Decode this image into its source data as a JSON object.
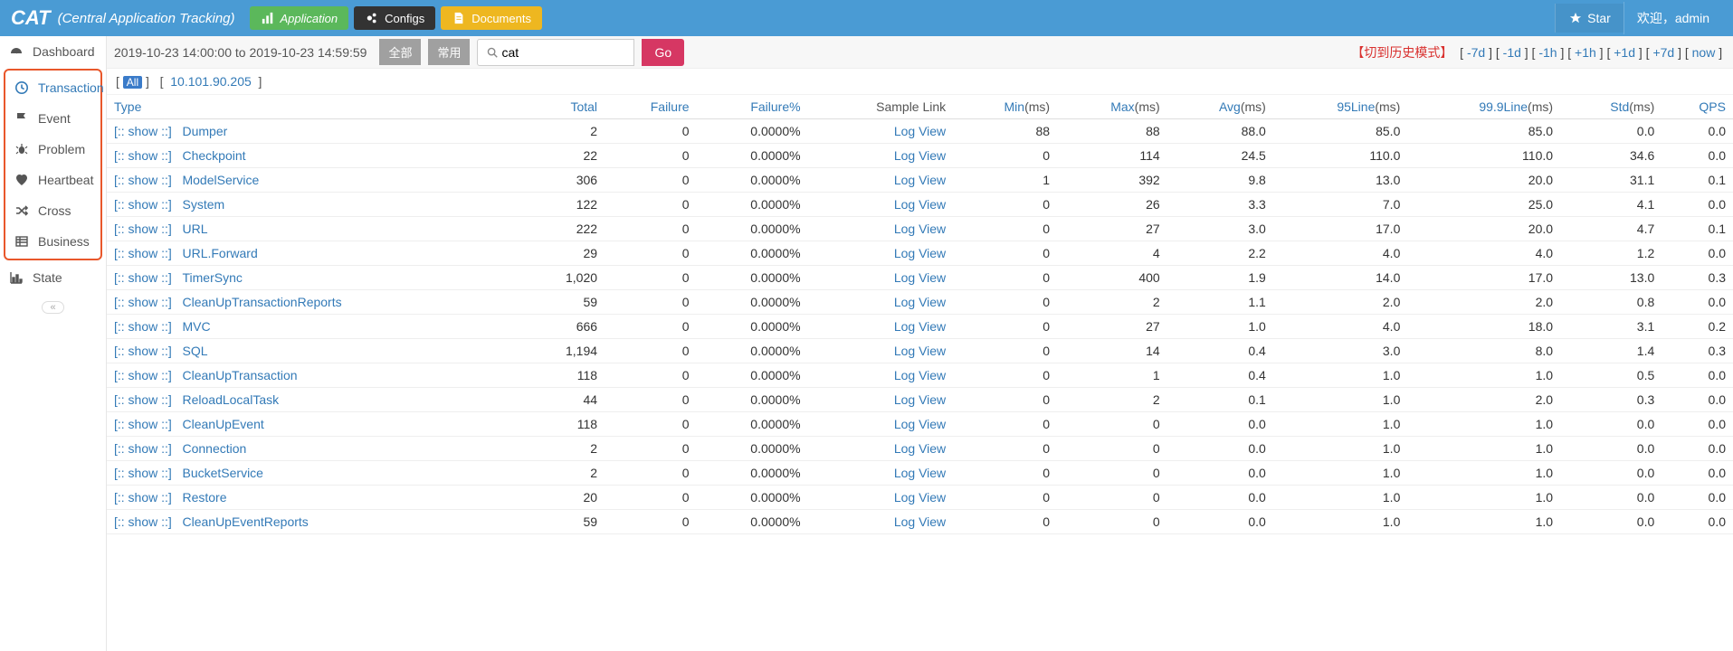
{
  "header": {
    "brand": "CAT",
    "brand_sub": "(Central Application Tracking)",
    "nav": {
      "application": "Application",
      "configs": "Configs",
      "documents": "Documents"
    },
    "star": "Star",
    "welcome": "欢迎，admin"
  },
  "sidebar": {
    "dashboard": "Dashboard",
    "transaction": "Transaction",
    "event": "Event",
    "problem": "Problem",
    "heartbeat": "Heartbeat",
    "cross": "Cross",
    "business": "Business",
    "state": "State",
    "collapse": "«"
  },
  "timebar": {
    "range": "2019-10-23 14:00:00 to 2019-10-23 14:59:59",
    "seg_all": "全部",
    "seg_common": "常用",
    "search_value": "cat",
    "go": "Go",
    "history_label": "【切到历史模式】",
    "links": {
      "m7d": "-7d",
      "m1d": "-1d",
      "m1h": "-1h",
      "p1h": "+1h",
      "p1d": "+1d",
      "p7d": "+7d",
      "now": "now"
    }
  },
  "iprow": {
    "all": "All",
    "ip": "10.101.90.205"
  },
  "table": {
    "headers": {
      "type": "Type",
      "total": "Total",
      "failure": "Failure",
      "failurep": "Failure%",
      "sample": "Sample Link",
      "min": "Min",
      "max": "Max",
      "avg": "Avg",
      "line95": "95Line",
      "line999": "99.9Line",
      "std": "Std",
      "qps": "QPS",
      "ms": "(ms)"
    },
    "show_label": "[:: show ::]",
    "log_label": "Log View",
    "rows": [
      {
        "type": "Dumper",
        "total": "2",
        "failure": "0",
        "failurep": "0.0000%",
        "min": "88",
        "max": "88",
        "avg": "88.0",
        "l95": "85.0",
        "l999": "85.0",
        "std": "0.0",
        "qps": "0.0"
      },
      {
        "type": "Checkpoint",
        "total": "22",
        "failure": "0",
        "failurep": "0.0000%",
        "min": "0",
        "max": "114",
        "avg": "24.5",
        "l95": "110.0",
        "l999": "110.0",
        "std": "34.6",
        "qps": "0.0"
      },
      {
        "type": "ModelService",
        "total": "306",
        "failure": "0",
        "failurep": "0.0000%",
        "min": "1",
        "max": "392",
        "avg": "9.8",
        "l95": "13.0",
        "l999": "20.0",
        "std": "31.1",
        "qps": "0.1"
      },
      {
        "type": "System",
        "total": "122",
        "failure": "0",
        "failurep": "0.0000%",
        "min": "0",
        "max": "26",
        "avg": "3.3",
        "l95": "7.0",
        "l999": "25.0",
        "std": "4.1",
        "qps": "0.0"
      },
      {
        "type": "URL",
        "total": "222",
        "failure": "0",
        "failurep": "0.0000%",
        "min": "0",
        "max": "27",
        "avg": "3.0",
        "l95": "17.0",
        "l999": "20.0",
        "std": "4.7",
        "qps": "0.1"
      },
      {
        "type": "URL.Forward",
        "total": "29",
        "failure": "0",
        "failurep": "0.0000%",
        "min": "0",
        "max": "4",
        "avg": "2.2",
        "l95": "4.0",
        "l999": "4.0",
        "std": "1.2",
        "qps": "0.0"
      },
      {
        "type": "TimerSync",
        "total": "1,020",
        "failure": "0",
        "failurep": "0.0000%",
        "min": "0",
        "max": "400",
        "avg": "1.9",
        "l95": "14.0",
        "l999": "17.0",
        "std": "13.0",
        "qps": "0.3"
      },
      {
        "type": "CleanUpTransactionReports",
        "total": "59",
        "failure": "0",
        "failurep": "0.0000%",
        "min": "0",
        "max": "2",
        "avg": "1.1",
        "l95": "2.0",
        "l999": "2.0",
        "std": "0.8",
        "qps": "0.0"
      },
      {
        "type": "MVC",
        "total": "666",
        "failure": "0",
        "failurep": "0.0000%",
        "min": "0",
        "max": "27",
        "avg": "1.0",
        "l95": "4.0",
        "l999": "18.0",
        "std": "3.1",
        "qps": "0.2"
      },
      {
        "type": "SQL",
        "total": "1,194",
        "failure": "0",
        "failurep": "0.0000%",
        "min": "0",
        "max": "14",
        "avg": "0.4",
        "l95": "3.0",
        "l999": "8.0",
        "std": "1.4",
        "qps": "0.3"
      },
      {
        "type": "CleanUpTransaction",
        "total": "118",
        "failure": "0",
        "failurep": "0.0000%",
        "min": "0",
        "max": "1",
        "avg": "0.4",
        "l95": "1.0",
        "l999": "1.0",
        "std": "0.5",
        "qps": "0.0"
      },
      {
        "type": "ReloadLocalTask",
        "total": "44",
        "failure": "0",
        "failurep": "0.0000%",
        "min": "0",
        "max": "2",
        "avg": "0.1",
        "l95": "1.0",
        "l999": "2.0",
        "std": "0.3",
        "qps": "0.0"
      },
      {
        "type": "CleanUpEvent",
        "total": "118",
        "failure": "0",
        "failurep": "0.0000%",
        "min": "0",
        "max": "0",
        "avg": "0.0",
        "l95": "1.0",
        "l999": "1.0",
        "std": "0.0",
        "qps": "0.0"
      },
      {
        "type": "Connection",
        "total": "2",
        "failure": "0",
        "failurep": "0.0000%",
        "min": "0",
        "max": "0",
        "avg": "0.0",
        "l95": "1.0",
        "l999": "1.0",
        "std": "0.0",
        "qps": "0.0"
      },
      {
        "type": "BucketService",
        "total": "2",
        "failure": "0",
        "failurep": "0.0000%",
        "min": "0",
        "max": "0",
        "avg": "0.0",
        "l95": "1.0",
        "l999": "1.0",
        "std": "0.0",
        "qps": "0.0"
      },
      {
        "type": "Restore",
        "total": "20",
        "failure": "0",
        "failurep": "0.0000%",
        "min": "0",
        "max": "0",
        "avg": "0.0",
        "l95": "1.0",
        "l999": "1.0",
        "std": "0.0",
        "qps": "0.0"
      },
      {
        "type": "CleanUpEventReports",
        "total": "59",
        "failure": "0",
        "failurep": "0.0000%",
        "min": "0",
        "max": "0",
        "avg": "0.0",
        "l95": "1.0",
        "l999": "1.0",
        "std": "0.0",
        "qps": "0.0"
      }
    ]
  }
}
